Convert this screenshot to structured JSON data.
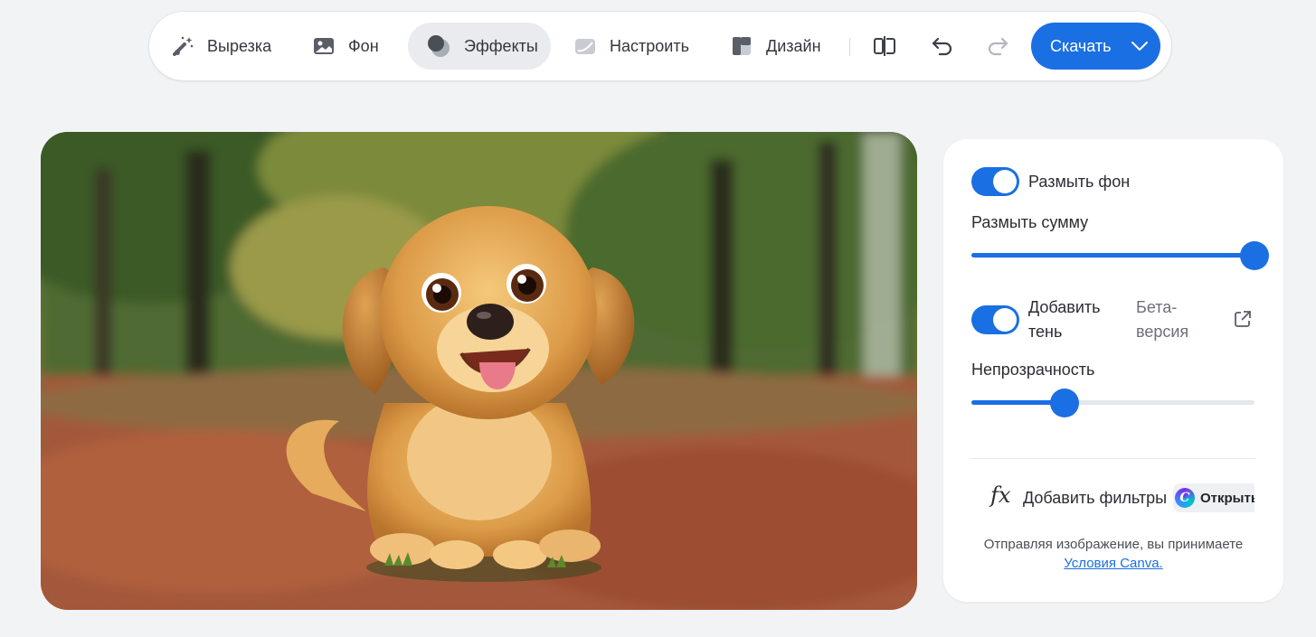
{
  "toolbar": {
    "items": [
      {
        "label": "Вырезка",
        "icon": "magic-wand-icon"
      },
      {
        "label": "Фон",
        "icon": "image-icon"
      },
      {
        "label": "Эффекты",
        "icon": "effects-icon",
        "active": true
      },
      {
        "label": "Настроить",
        "icon": "adjust-icon"
      },
      {
        "label": "Дизайн",
        "icon": "layout-icon"
      }
    ],
    "compare_icon": "compare-icon",
    "undo_icon": "undo-icon",
    "redo_icon": "redo-icon",
    "download_label": "Скачать",
    "download_icon": "chevron-down-icon"
  },
  "canvas": {
    "subject": "puppy-image"
  },
  "panel": {
    "blur_toggle": {
      "label": "Размыть фон",
      "on": true
    },
    "blur_amount": {
      "label": "Размыть сумму",
      "value_percent": 100
    },
    "shadow_toggle": {
      "label_line1": "Добавить",
      "label_line2": "тень",
      "on": true
    },
    "beta_line1": "Бета-",
    "beta_line2": "версия",
    "external_icon": "external-link-icon",
    "opacity": {
      "label": "Непрозрачность",
      "value_percent": 33
    },
    "filters": {
      "icon": "fx-icon",
      "icon_text": "fx",
      "label": "Добавить фильтры",
      "open_label": "Открыть",
      "logo_text": "C"
    },
    "terms_text": "Отправляя изображение, вы принимаете",
    "terms_link": "Условия Canva."
  },
  "colors": {
    "accent": "#1a6fe3",
    "background": "#f2f3f5",
    "active_tab": "#e9ebee"
  }
}
